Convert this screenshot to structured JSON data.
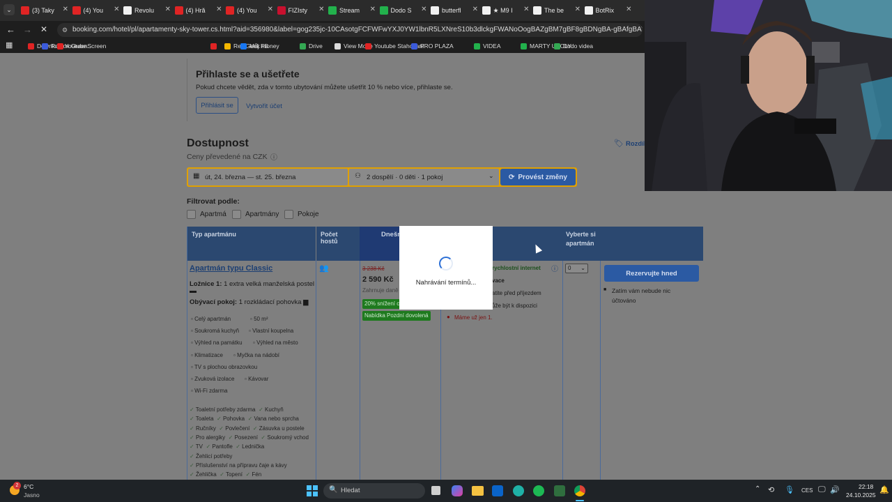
{
  "tabs": [
    {
      "label": "(3) Taky",
      "color": "#e02424"
    },
    {
      "label": "(4) You",
      "color": "#e02424"
    },
    {
      "label": "Revolu",
      "color": "#f1f1f1"
    },
    {
      "label": "(4) Hră",
      "color": "#e02424"
    },
    {
      "label": "(4) You",
      "color": "#e02424"
    },
    {
      "label": "FIZIsty",
      "color": "#c8102e"
    },
    {
      "label": "Stream",
      "color": "#22b14c"
    },
    {
      "label": "Dodo S",
      "color": "#22b14c"
    },
    {
      "label": "butterfl",
      "color": "#f1f1f1"
    },
    {
      "label": "★ M9 I",
      "color": "#f1f1f1"
    },
    {
      "label": "The be",
      "color": "#f1f1f1"
    },
    {
      "label": "BotRix",
      "color": "#f1f1f1"
    }
  ],
  "url": "booking.com/hotel/pl/apartamenty-sky-tower.cs.html?aid=356980&label=gog235jc-10CAsotgFCFWFwYXJ0YW1lbnR5LXNreS10b3dlckgFWANoOogBAZgBM7gBF8gBDNgBA-gBAfgBAYgCAAbgC...",
  "bookmarks": [
    {
      "label": "Download Youtube...",
      "color": "#e02424"
    },
    {
      "label": "Roblox GreenScreen",
      "color": "#3b5bdb"
    },
    {
      "label": "",
      "color": "#e02424"
    },
    {
      "label": "",
      "color": "#e02424"
    },
    {
      "label": "RealGeek money",
      "color": "#f5b700"
    },
    {
      "label": "Můj FB",
      "color": "#1877f2"
    },
    {
      "label": "Drive",
      "color": "#34a853"
    },
    {
      "label": "View Mode",
      "color": "#dcdcdc"
    },
    {
      "label": "Youtube Stahovaní",
      "color": "#e02424"
    },
    {
      "label": "PRO PLAZA",
      "color": "#3b5bdb"
    },
    {
      "label": "VIDEA",
      "color": "#22b14c"
    },
    {
      "label": "MARTY UKOLY",
      "color": "#22b14c"
    },
    {
      "label": "Dodo videa",
      "color": "#34a853"
    }
  ],
  "signin": {
    "title": "Přihlaste se a ušetřete",
    "text": "Pokud chcete vědět, zda v tomto ubytování můžete ušetřit 10 % nebo více, přihlaste se.",
    "login": "Přihlásit se",
    "create": "Vytvořit účet"
  },
  "availability": {
    "title": "Dostupnost",
    "subtitle": "Ceny převedené na CZK",
    "compare": "Rozdíl",
    "dates": "út, 24. března  —  st. 25. března",
    "guests": "2 dospělí · 0 děti · 1 pokoj",
    "apply": "Provést změny"
  },
  "filter": {
    "title": "Filtrovat podle:",
    "options": [
      "Apartmá",
      "Apartmány",
      "Pokoje"
    ]
  },
  "table": {
    "col_type": "Typ apartmánu",
    "col_guests": "Počet hostů",
    "col_today": "Dnešní",
    "col_select": "Vyberte si apartmán",
    "room_name": "Apartmán typu Classic",
    "bedroom_label": "Ložnice 1:",
    "bedroom_text": "1 extra velká manželská postel",
    "living_label": "Obývací pokoj:",
    "living_text": "1 rozkládací pohovka",
    "features": [
      [
        "Celý apartmán",
        "50 m²"
      ],
      [
        "Soukromá kuchyň",
        "Vlastní koupelna"
      ],
      [
        "Výhled na památku",
        "Výhled na město"
      ],
      [
        "Klimatizace",
        "Myčka na nádobí"
      ],
      [
        "TV s plochou obrazovkou"
      ],
      [
        "Zvuková izolace",
        "Kávovar"
      ],
      [
        "Wi-Fi zdarma"
      ]
    ],
    "amenities": [
      [
        "Toaletní potřeby zdarma",
        "Kuchyň"
      ],
      [
        "Toaleta",
        "Pohovka",
        "Vana nebo sprcha"
      ],
      [
        "Ručníky",
        "Povlečení",
        "Zásuvka u postele"
      ],
      [
        "Pro alergiky",
        "Posezení",
        "Soukromý vchod"
      ],
      [
        "TV",
        "Pantofle",
        "Lednička"
      ],
      [
        "Žehlicí potřeby"
      ],
      [
        "Příslušenství na přípravu čaje a kávy"
      ],
      [
        "Žehlička",
        "Topení",
        "Fén"
      ]
    ],
    "old_price": "3 238 Kč",
    "price": "2 590 Kč",
    "taxes": "Zahrnuje daně",
    "badge_discount": "20% snížení c",
    "badge_late": "Nabídka Pozdní dovolená",
    "wifi": "rychlostní internet",
    "breakfast": "vace",
    "cancel1": "atite před příjezdem",
    "cancel2": "ůže být k dispozici",
    "last": "Máme už jen 1.",
    "select_value": "0",
    "reserve": "Rezervujte hned",
    "note1": "Zatím vám nebude nic",
    "note2": "účtováno"
  },
  "modal": {
    "text": "Nahrávání termínů..."
  },
  "taskbar": {
    "temp": "6°C",
    "weather": "Jasno",
    "badge": "2",
    "search": "Hledat",
    "lang": "CES",
    "time": "22:18",
    "date": "24.10.2025"
  }
}
